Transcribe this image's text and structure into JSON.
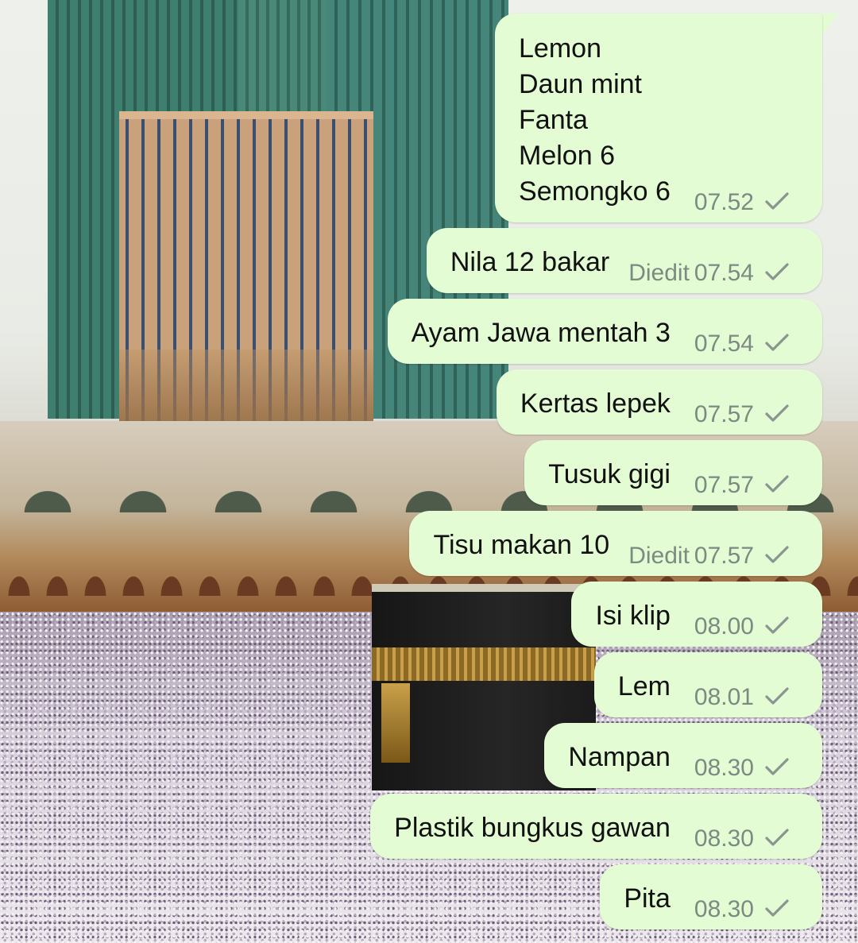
{
  "chat": {
    "messages": [
      {
        "text": "Lemon\nDaun mint\nFanta\nMelon 6\nSemongko 6",
        "edited": "",
        "time": "07.52",
        "status": "sent-check-icon"
      },
      {
        "text": "Nila 12 bakar",
        "edited": "Diedit",
        "time": "07.54",
        "status": "sent-check-icon"
      },
      {
        "text": "Ayam Jawa mentah 3",
        "edited": "",
        "time": "07.54",
        "status": "sent-check-icon"
      },
      {
        "text": "Kertas lepek",
        "edited": "",
        "time": "07.57",
        "status": "sent-check-icon"
      },
      {
        "text": "Tusuk gigi",
        "edited": "",
        "time": "07.57",
        "status": "sent-check-icon"
      },
      {
        "text": "Tisu makan 10",
        "edited": "Diedit",
        "time": "07.57",
        "status": "sent-check-icon"
      },
      {
        "text": "Isi klip",
        "edited": "",
        "time": "08.00",
        "status": "sent-check-icon"
      },
      {
        "text": "Lem",
        "edited": "",
        "time": "08.01",
        "status": "sent-check-icon"
      },
      {
        "text": "Nampan",
        "edited": "",
        "time": "08.30",
        "status": "sent-check-icon"
      },
      {
        "text": "Plastik bungkus gawan",
        "edited": "",
        "time": "08.30",
        "status": "sent-check-icon"
      },
      {
        "text": "Pita",
        "edited": "",
        "time": "08.30",
        "status": "sent-check-icon"
      }
    ]
  },
  "colors": {
    "bubble_outgoing": "#e4fcd4",
    "meta_text": "#7c8a82",
    "message_text": "#111111"
  }
}
